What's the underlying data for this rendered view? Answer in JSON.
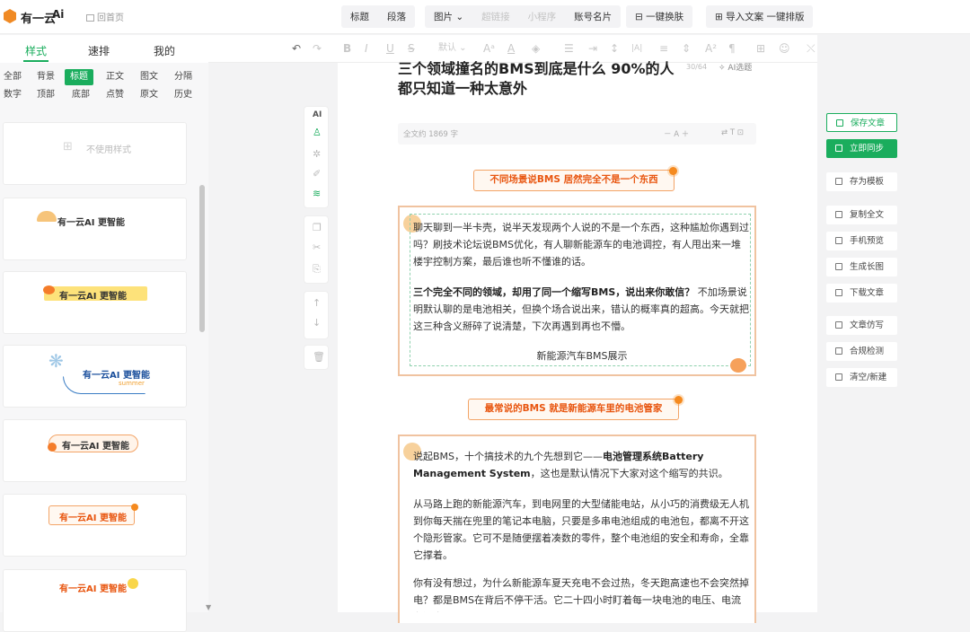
{
  "app": {
    "name": "有一云",
    "home": "回首页"
  },
  "toolbar_groups": [
    {
      "items": [
        {
          "label": "标题"
        },
        {
          "label": "段落"
        }
      ]
    },
    {
      "items": [
        {
          "label": "图片"
        },
        {
          "label": "超链接",
          "disabled": true
        },
        {
          "label": "小程序",
          "disabled": true
        },
        {
          "label": "账号名片"
        }
      ]
    },
    {
      "items": [
        {
          "label": "一键换肤"
        }
      ]
    },
    {
      "items": [
        {
          "label": "导入文案 一键排版"
        }
      ]
    }
  ],
  "left_tabs": [
    {
      "label": "样式",
      "active": true
    },
    {
      "label": "速排"
    },
    {
      "label": "我的"
    }
  ],
  "categories_row1": [
    "全部",
    "背景",
    "标题",
    "正文",
    "图文",
    "分隔"
  ],
  "categories_row2": [
    "数字",
    "顶部",
    "底部",
    "点赞",
    "原文",
    "历史"
  ],
  "active_category": "标题",
  "format": {
    "font_size": "默认"
  },
  "style_cards": [
    {
      "label": "不使用样式"
    },
    {
      "label": "有一云AI 更智能"
    },
    {
      "label": "有一云AI 更智能"
    },
    {
      "label": "有一云AI 更智能",
      "sub": "summer"
    },
    {
      "label": "有一云AI 更智能",
      "crown": true
    },
    {
      "label": "有一云AI 更智能",
      "crown": true
    },
    {
      "label": "有一云AI 更智能",
      "crown": true
    }
  ],
  "vtools": {
    "ai": "AI"
  },
  "article": {
    "title": "三个领域撞名的BMS到底是什么 90%的人都只知道一种太意外",
    "counter": "30/64",
    "ai_title": "AI选题",
    "word_count": "全文约 1869 字",
    "size_ctrl": "－ A ＋",
    "heading1": "不同场景说BMS 居然完全不是一个东西",
    "p1": "聊天聊到一半卡壳，说半天发现两个人说的不是一个东西，这种尴尬你遇到过吗？刷技术论坛说BMS优化，有人聊新能源车的电池调控，有人甩出来一堆楼宇控制方案，最后谁也听不懂谁的话。",
    "p2_bold": "三个完全不同的领域，却用了同一个缩写BMS，说出来你敢信？",
    "p2_rest": "不加场景说明默认聊的是电池相关，但换个场合说出来，错认的概率真的超高。今天就把这三种含义掰碎了说清楚，下次再遇到再也不懵。",
    "caption": "新能源汽车BMS展示",
    "heading2": "最常说的BMS 就是新能源车里的电池管家",
    "p3_a": "说起BMS，十个搞技术的九个先想到它——",
    "p3_bold": "电池管理系统Battery Management System",
    "p3_b": "，这也是默认情况下大家对这个缩写的共识。",
    "p4": "从马路上跑的新能源汽车，到电网里的大型储能电站，从小巧的消费级无人机到你每天揣在兜里的笔记本电脑，只要是多串电池组成的电池包，都离不开这个隐形管家。它可不是随便摆着凑数的零件，整个电池组的安全和寿命，全靠它撑着。",
    "p5": "你有没有想过，为什么新能源车夏天充电不会过热，冬天跑高速也不会突然掉电？都是BMS在背后不停干活。它二十四小时盯着每一块电池的电压、电流和温度，"
  },
  "right_actions": [
    {
      "label": "保存文章",
      "style": "outline"
    },
    {
      "label": "立即同步",
      "style": "fill"
    },
    {
      "label": "存为模板"
    },
    {
      "label": "复制全文"
    },
    {
      "label": "手机预览"
    },
    {
      "label": "生成长图"
    },
    {
      "label": "下载文章"
    },
    {
      "label": "文章仿写"
    },
    {
      "label": "合规检测"
    },
    {
      "label": "清空/新建"
    }
  ],
  "colors": {
    "accent": "#1aad5d",
    "heading": "#e8550f",
    "border": "#f3a467"
  }
}
